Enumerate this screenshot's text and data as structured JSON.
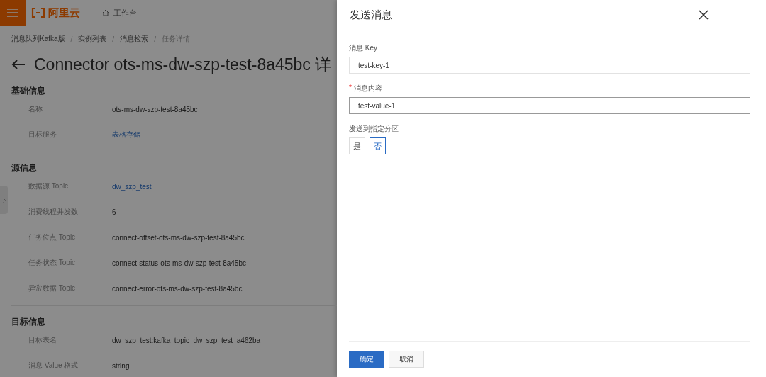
{
  "header": {
    "logo": "阿里云",
    "nav": "工作台"
  },
  "breadcrumb": [
    "消息队列Kafka版",
    "实例列表",
    "消息检索",
    "任务详情"
  ],
  "breadcrumb_separator": "/",
  "page_title": "Connector ots-ms-dw-szp-test-8a45bc 详",
  "sections": [
    {
      "title": "基础信息",
      "rows": [
        {
          "label": "名称",
          "value": "ots-ms-dw-szp-test-8a45bc",
          "link": false
        },
        {
          "label": "目标服务",
          "value": "表格存储",
          "link": true
        }
      ]
    },
    {
      "title": "源信息",
      "rows": [
        {
          "label": "数据源 Topic",
          "value": "dw_szp_test",
          "link": true
        },
        {
          "label": "消费线程并发数",
          "value": "6",
          "link": false
        },
        {
          "label": "任务位点 Topic",
          "value": "connect-offset-ots-ms-dw-szp-test-8a45bc",
          "link": false
        },
        {
          "label": "任务状态 Topic",
          "value": "connect-status-ots-ms-dw-szp-test-8a45bc",
          "link": false
        },
        {
          "label": "异常数据 Topic",
          "value": "connect-error-ots-ms-dw-szp-test-8a45bc",
          "link": false
        }
      ]
    },
    {
      "title": "目标信息",
      "rows": [
        {
          "label": "目标表名",
          "value": "dw_szp_test:kafka_topic_dw_szp_test_a462ba",
          "link": false
        },
        {
          "label": "消息 Value 格式",
          "value": "string",
          "link": false
        }
      ]
    }
  ],
  "drawer": {
    "title": "发送消息",
    "fields": [
      {
        "kind": "text",
        "label": "消息 Key",
        "value": "test-key-1",
        "focused": false
      },
      {
        "kind": "text",
        "label": "消息内容",
        "required_mark": "*",
        "value": "test-value-1",
        "focused": true
      },
      {
        "kind": "choice",
        "label": "发送到指定分区",
        "options": [
          {
            "label": "是",
            "selected": false
          },
          {
            "label": "否",
            "selected": true
          }
        ]
      }
    ],
    "buttons": [
      {
        "label": "确定",
        "kind": "primary"
      },
      {
        "label": "取消",
        "kind": "secondary"
      }
    ]
  }
}
